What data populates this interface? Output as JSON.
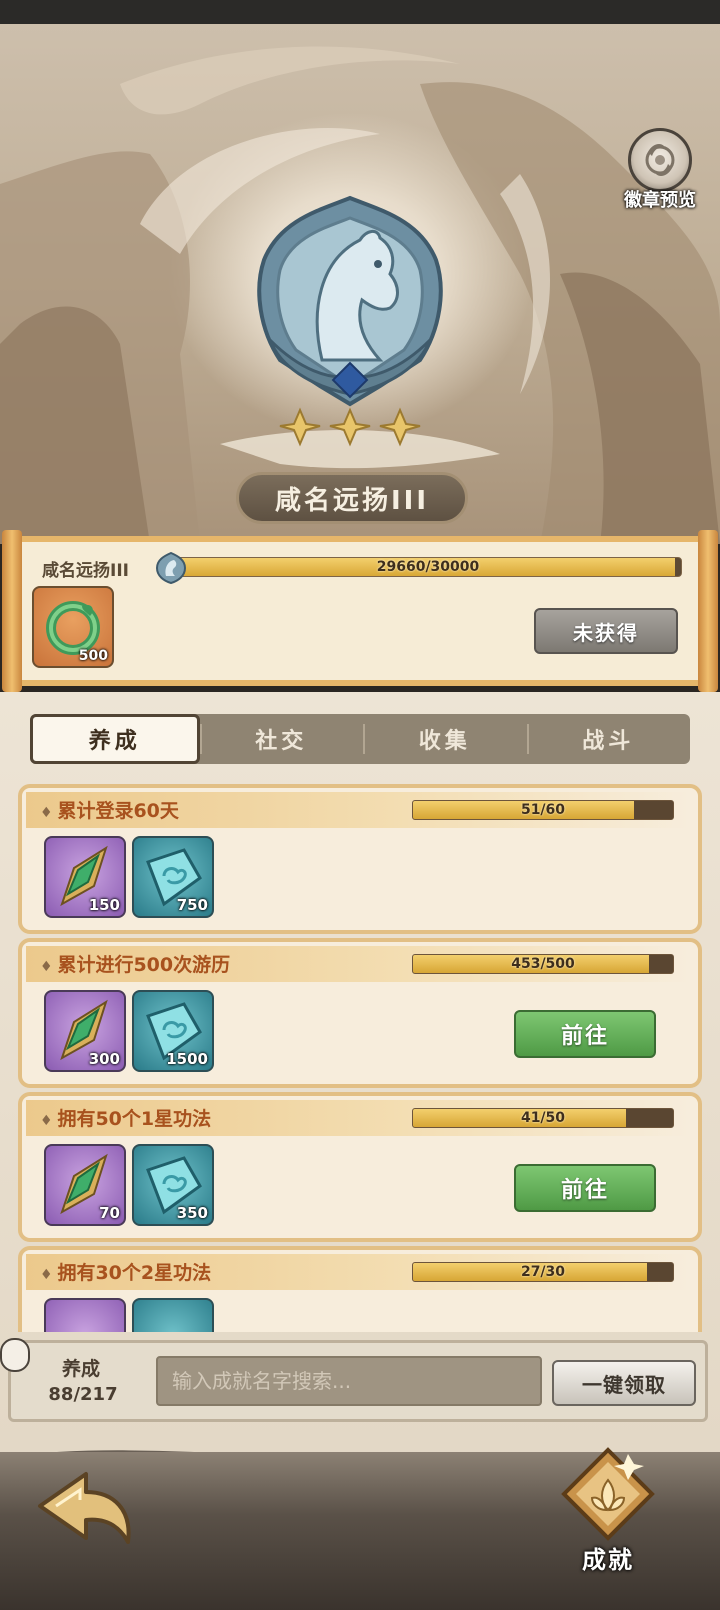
{
  "header": {
    "preview_label": "徽章预览"
  },
  "badge": {
    "title": "咸名远扬III",
    "stars": 3,
    "name_small": "咸名远扬III",
    "progress_text": "29660/30000",
    "progress_fraction": 0.9887,
    "reward_count": "500",
    "status_button": "未获得"
  },
  "tabs": [
    {
      "label": "养成",
      "active": true
    },
    {
      "label": "社交",
      "active": false
    },
    {
      "label": "收集",
      "active": false
    },
    {
      "label": "战斗",
      "active": false
    }
  ],
  "achievements": [
    {
      "title": "累计登录60天",
      "progress_text": "51/60",
      "progress_fraction": 0.85,
      "rewards": [
        "150",
        "750"
      ],
      "action": ""
    },
    {
      "title": "累计进行500次游历",
      "progress_text": "453/500",
      "progress_fraction": 0.906,
      "rewards": [
        "300",
        "1500"
      ],
      "action": "前往"
    },
    {
      "title": "拥有50个1星功法",
      "progress_text": "41/50",
      "progress_fraction": 0.82,
      "rewards": [
        "70",
        "350"
      ],
      "action": "前往"
    },
    {
      "title": "拥有30个2星功法",
      "progress_text": "27/30",
      "progress_fraction": 0.9,
      "rewards": [
        "",
        ""
      ],
      "action": ""
    }
  ],
  "footer": {
    "category_name": "养成",
    "category_count": "88/217",
    "search_placeholder": "输入成就名字搜索...",
    "claim_all_label": "一键领取"
  },
  "nav": {
    "achievement_label": "成就"
  },
  "colors": {
    "progress_fill": "#f3cf6d",
    "achievement_title": "#a8521e",
    "go_button": "#5fae55",
    "tab_active_bg": "#fbf6ec"
  }
}
